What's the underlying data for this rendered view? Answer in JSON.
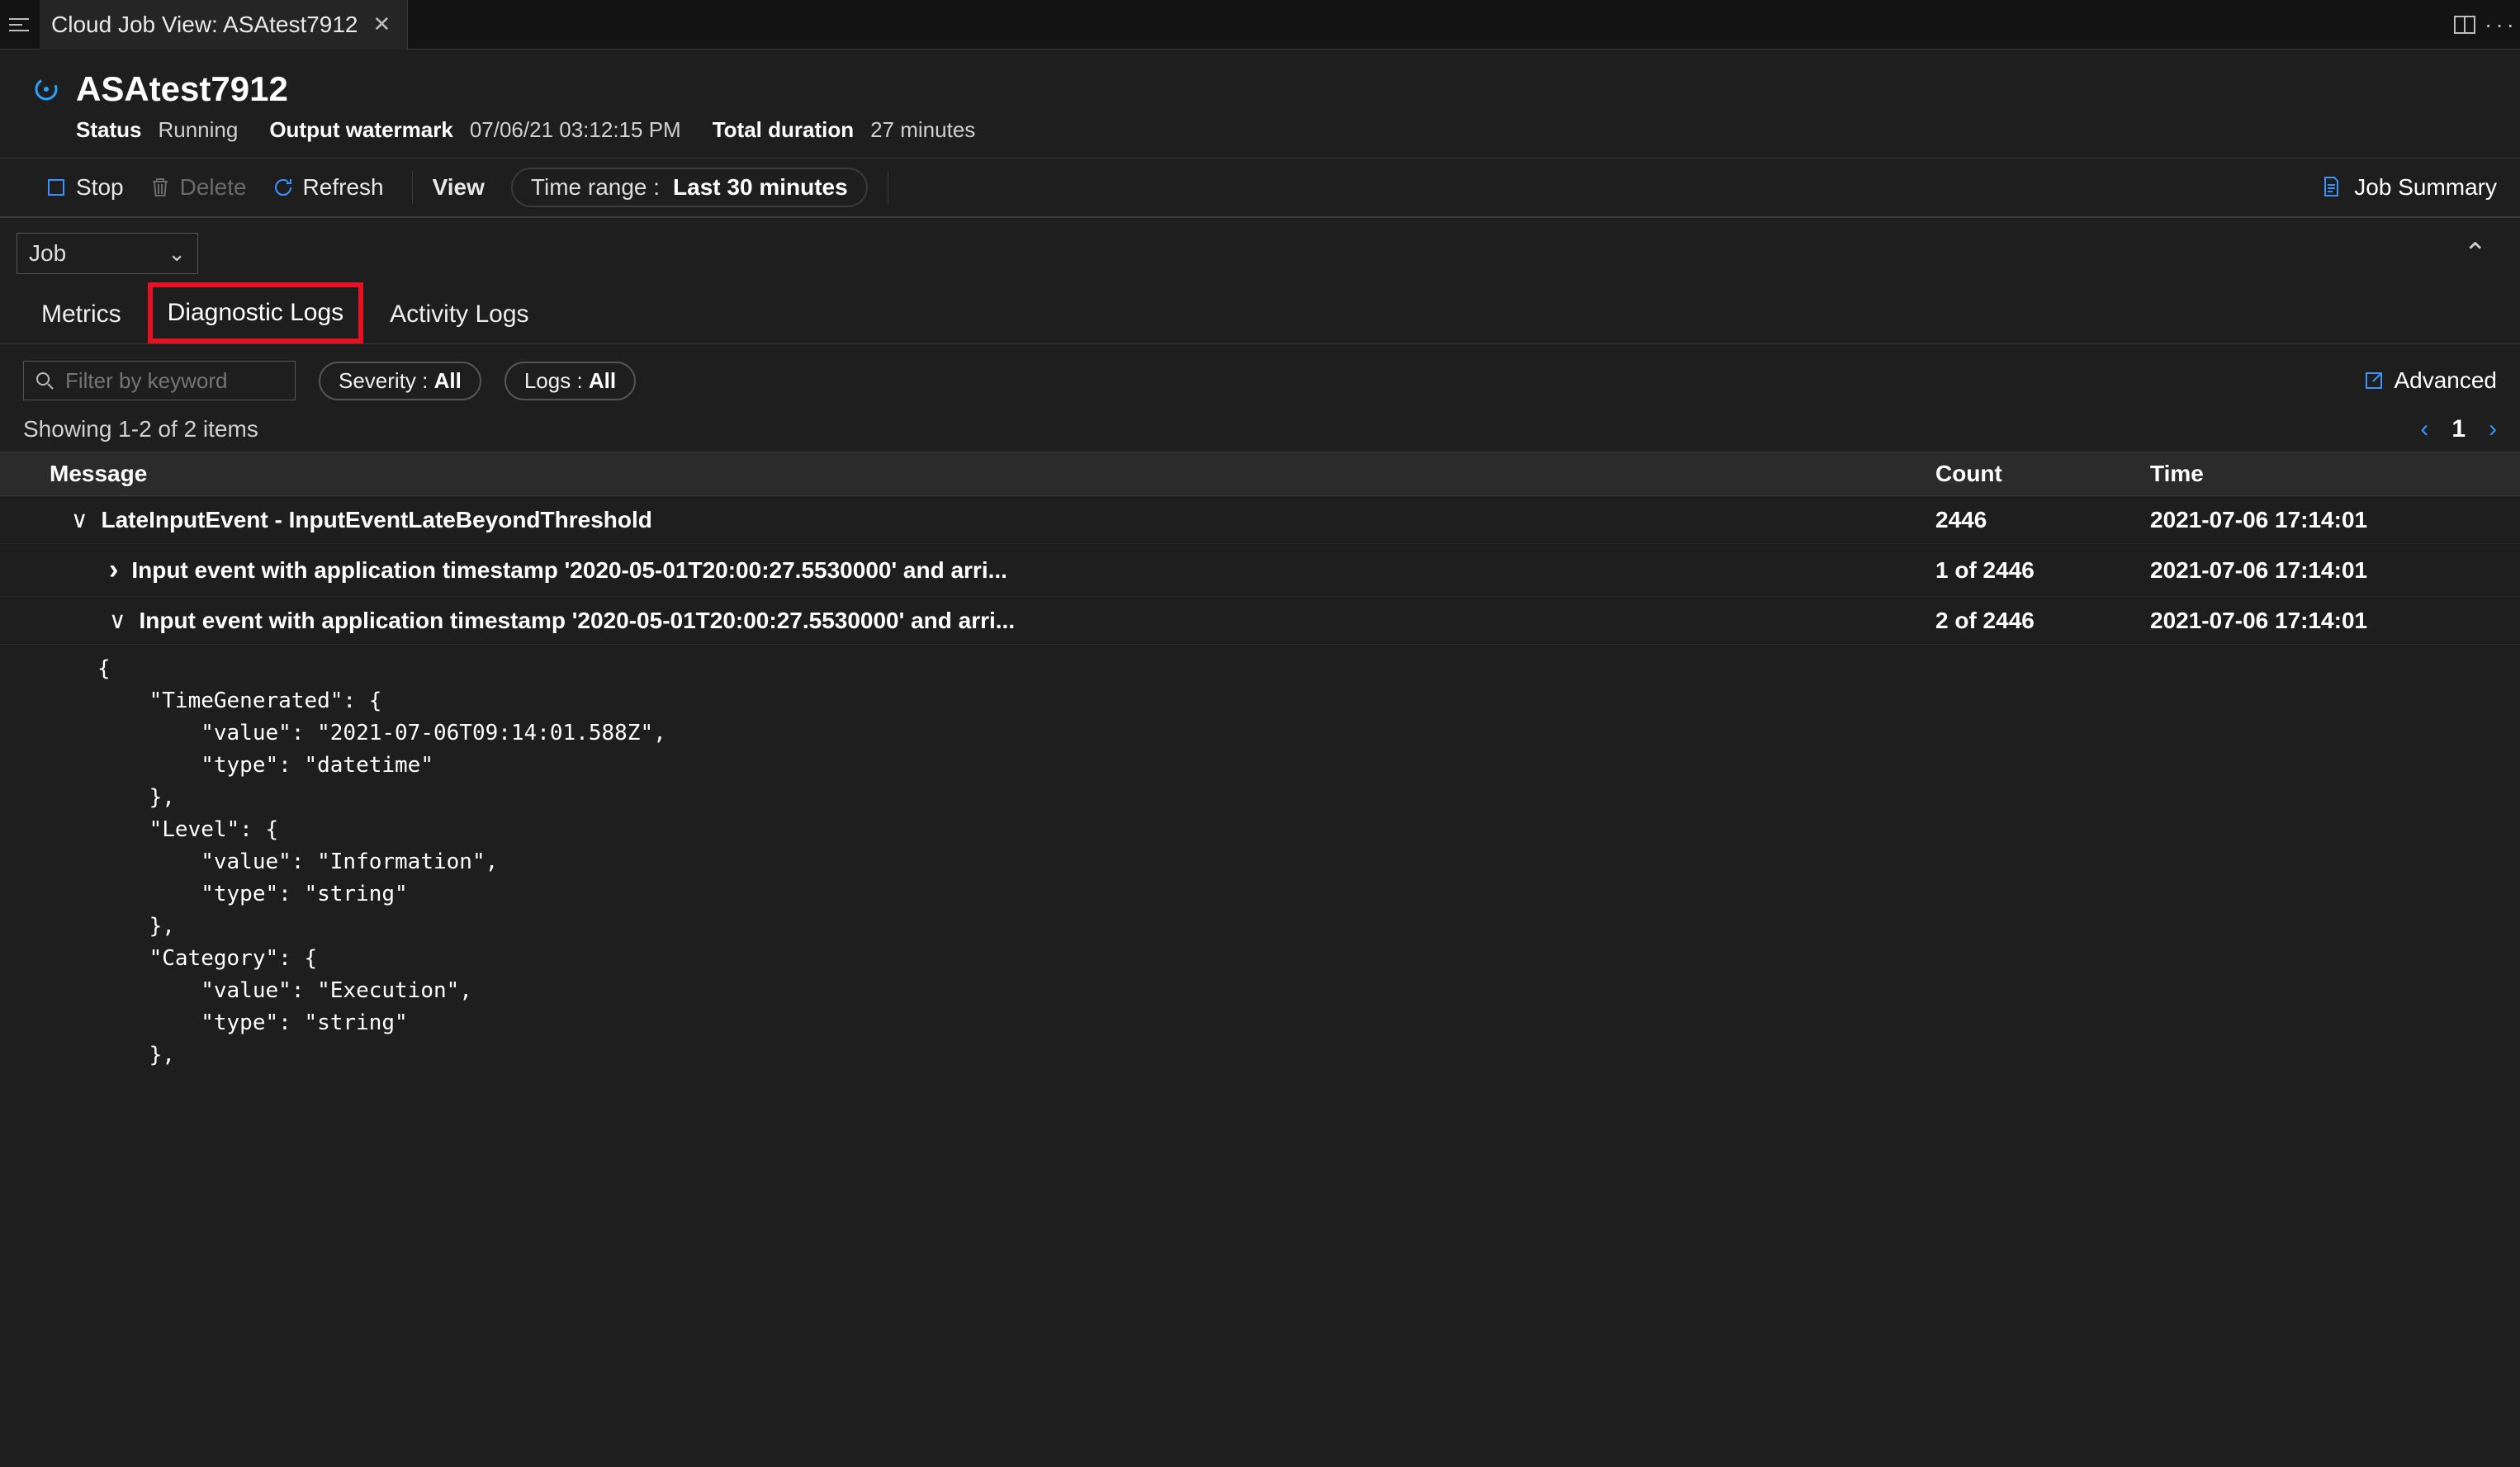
{
  "tabbar": {
    "title": "Cloud Job View: ASAtest7912"
  },
  "header": {
    "title": "ASAtest7912",
    "status_label": "Status",
    "status_value": "Running",
    "watermark_label": "Output watermark",
    "watermark_value": "07/06/21 03:12:15 PM",
    "duration_label": "Total duration",
    "duration_value": "27 minutes"
  },
  "toolbar": {
    "stop": "Stop",
    "delete": "Delete",
    "refresh": "Refresh",
    "view": "View",
    "time_range_label": "Time range :",
    "time_range_value": "Last 30 minutes",
    "summary": "Job Summary"
  },
  "scope": {
    "value": "Job"
  },
  "tabs": {
    "metrics": "Metrics",
    "diag": "Diagnostic Logs",
    "activity": "Activity Logs"
  },
  "filters": {
    "placeholder": "Filter by keyword",
    "severity_label": "Severity :",
    "severity_value": "All",
    "logs_label": "Logs :",
    "logs_value": "All",
    "advanced": "Advanced"
  },
  "showing": {
    "text": "Showing 1-2 of 2 items",
    "page": "1"
  },
  "columns": {
    "message": "Message",
    "count": "Count",
    "time": "Time"
  },
  "rows": {
    "r0": {
      "message": "LateInputEvent - InputEventLateBeyondThreshold",
      "count": "2446",
      "time": "2021-07-06 17:14:01"
    },
    "r1": {
      "message": "Input event with application timestamp '2020-05-01T20:00:27.5530000' and arri...",
      "count": "1 of 2446",
      "time": "2021-07-06 17:14:01"
    },
    "r2": {
      "message": "Input event with application timestamp '2020-05-01T20:00:27.5530000' and arri...",
      "count": "2 of 2446",
      "time": "2021-07-06 17:14:01"
    }
  },
  "detail_json": "{\n    \"TimeGenerated\": {\n        \"value\": \"2021-07-06T09:14:01.588Z\",\n        \"type\": \"datetime\"\n    },\n    \"Level\": {\n        \"value\": \"Information\",\n        \"type\": \"string\"\n    },\n    \"Category\": {\n        \"value\": \"Execution\",\n        \"type\": \"string\"\n    },"
}
